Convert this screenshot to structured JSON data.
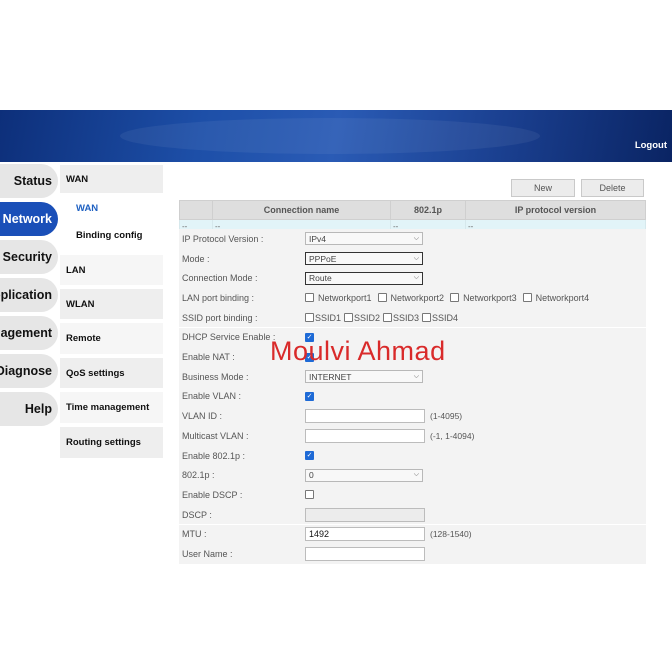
{
  "header": {
    "logout": "Logout"
  },
  "tabs": [
    "Status",
    "Network",
    "Security",
    "Application",
    "Management",
    "Diagnose",
    "Help"
  ],
  "submenu": {
    "wan": "WAN",
    "wan_sel": "WAN",
    "binding": "Binding config",
    "lan": "LAN",
    "wlan": "WLAN",
    "remote": "Remote",
    "qos": "QoS settings",
    "time": "Time management",
    "routing": "Routing settings"
  },
  "buttons": {
    "new": "New",
    "delete": "Delete"
  },
  "table": {
    "headers": [
      "",
      "Connection name",
      "802.1p",
      "IP protocol version"
    ],
    "row": [
      "--",
      "--",
      "--",
      "--"
    ]
  },
  "form": {
    "ip_version": {
      "label": "IP Protocol Version :",
      "value": "IPv4"
    },
    "mode": {
      "label": "Mode :",
      "value": "PPPoE"
    },
    "conn_mode": {
      "label": "Connection Mode :",
      "value": "Route"
    },
    "lan_binding": {
      "label": "LAN port binding :",
      "options": [
        "Networkport1",
        "Networkport2",
        "Networkport3",
        "Networkport4"
      ]
    },
    "ssid_binding": {
      "label": "SSID port binding :",
      "options": [
        "SSID1",
        "SSID2",
        "SSID3",
        "SSID4"
      ]
    },
    "dhcp": {
      "label": "DHCP Service Enable :"
    },
    "nat": {
      "label": "Enable NAT :"
    },
    "business": {
      "label": "Business Mode :",
      "value": "INTERNET"
    },
    "vlan": {
      "label": "Enable VLAN :"
    },
    "vlan_id": {
      "label": "VLAN ID :",
      "value": "",
      "hint": "(1-4095)"
    },
    "multicast": {
      "label": "Multicast VLAN :",
      "value": "",
      "hint": "(-1, 1-4094)"
    },
    "enable_8021p": {
      "label": "Enable 802.1p :"
    },
    "p8021": {
      "label": "802.1p :",
      "value": "0"
    },
    "dscp_enable": {
      "label": "Enable DSCP :"
    },
    "dscp": {
      "label": "DSCP :",
      "value": ""
    },
    "mtu": {
      "label": "MTU :",
      "value": "1492",
      "hint": "(128-1540)"
    },
    "username": {
      "label": "User Name :",
      "value": ""
    }
  },
  "watermark": "Moulvi Ahmad",
  "icons": {
    "checkbox_checked": "check-icon",
    "dropdown": "chevron-down-icon"
  },
  "colors": {
    "banner": "#1d4fa8",
    "active_tab": "#1a4fb8",
    "watermark": "#d92a2a",
    "link_selected": "#1f61c2"
  }
}
